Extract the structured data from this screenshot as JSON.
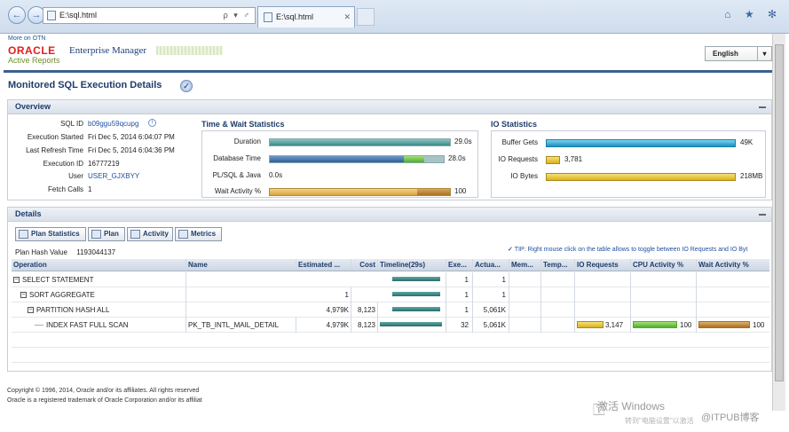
{
  "browser": {
    "address": "E:\\sql.html",
    "tab_title": "E:\\sql.html",
    "addr_tools": "ρ ▾ ♂",
    "window_icons": "⌂ ★ ✻"
  },
  "header": {
    "more_otn": "More on OTN",
    "oracle": "ORACLE",
    "product": "Enterprise Manager",
    "subproduct": "Active Reports",
    "language": "English"
  },
  "page_title": "Monitored SQL Execution Details",
  "overview": {
    "heading": "Overview",
    "fields": [
      {
        "label": "SQL ID",
        "value": "b09ggu59qcupg",
        "link": true
      },
      {
        "label": "Execution Started",
        "value": "Fri Dec 5, 2014 6:04:07 PM"
      },
      {
        "label": "Last Refresh Time",
        "value": "Fri Dec 5, 2014 6:04:36 PM"
      },
      {
        "label": "Execution ID",
        "value": "16777219"
      },
      {
        "label": "User",
        "value": "USER_GJXBYY",
        "link": true
      },
      {
        "label": "Fetch Calls",
        "value": "1"
      }
    ],
    "time_wait": {
      "title": "Time & Wait Statistics",
      "rows": [
        {
          "label": "Duration",
          "value": "29.0s",
          "fraction": 1.0
        },
        {
          "label": "Database Time",
          "value": "28.0s",
          "fraction": 0.97
        },
        {
          "label": "PL/SQL & Java",
          "value": "0.0s",
          "fraction": 0
        },
        {
          "label": "Wait Activity %",
          "value": "100",
          "fraction": 1.0
        }
      ]
    },
    "io": {
      "title": "IO Statistics",
      "rows": [
        {
          "label": "Buffer Gets",
          "value": "49K",
          "fraction": 1.0
        },
        {
          "label": "IO Requests",
          "value": "3,781",
          "fraction": 0.08
        },
        {
          "label": "IO Bytes",
          "value": "218MB",
          "fraction": 1.0
        }
      ]
    }
  },
  "details": {
    "heading": "Details",
    "buttons": [
      "Plan Statistics",
      "Plan",
      "Activity",
      "Metrics"
    ],
    "tip": "TIP: Right mouse click on the table allows to toggle between IO Requests and IO Byt",
    "plan_hash_label": "Plan Hash Value",
    "plan_hash_value": "1193044137",
    "columns": [
      "Operation",
      "Name",
      "Estimated ...",
      "Cost",
      "Timeline(29s)",
      "Exe...",
      "Actua...",
      "Mem...",
      "Temp...",
      "IO Requests",
      "CPU Activity %",
      "Wait Activity %"
    ],
    "rows": [
      {
        "op": "SELECT STATEMENT",
        "indent": 0,
        "tree": "⊟",
        "name": "",
        "est": "",
        "cost": "",
        "tl": 0.95,
        "exe": "1",
        "act": "1",
        "io": "",
        "cpu": "",
        "wait": ""
      },
      {
        "op": "SORT AGGREGATE",
        "indent": 1,
        "tree": "⊟",
        "name": "",
        "est": "1",
        "cost": "",
        "tl": 0.95,
        "exe": "1",
        "act": "1",
        "io": "",
        "cpu": "",
        "wait": ""
      },
      {
        "op": "PARTITION HASH ALL",
        "indent": 2,
        "tree": "⊟",
        "name": "",
        "est": "4,979K",
        "cost": "8,123",
        "tl": 0.95,
        "exe": "1",
        "act": "5,061K",
        "io": "",
        "cpu": "",
        "wait": ""
      },
      {
        "op": "INDEX FAST FULL SCAN",
        "indent": 3,
        "tree": "",
        "name": "PK_TB_INTL_MAIL_DETAIL",
        "est": "4,979K",
        "cost": "8,123",
        "tl": 1.0,
        "exe": "32",
        "act": "5,061K",
        "io": "3,147",
        "cpu": "100",
        "wait": "100"
      }
    ]
  },
  "footer": {
    "line1": "Copyright © 1996, 2014, Oracle and/or its affiliates. All rights reserved",
    "line2": "Oracle is a registered trademark of Oracle Corporation and/or its affiliat"
  },
  "watermark": {
    "activate": "激活 Windows",
    "hint": "转到\"电脑设置\"以激活",
    "brand": "@ITPUB博客"
  },
  "colors": {
    "accent": "#1f3c6a",
    "duration": "#3a8a88",
    "dbtime": "#2c5f9a",
    "cpu": "#6abf3b",
    "wait": "#c08a2e",
    "io": "#1aa3d6",
    "iob": "#d9b21a"
  }
}
